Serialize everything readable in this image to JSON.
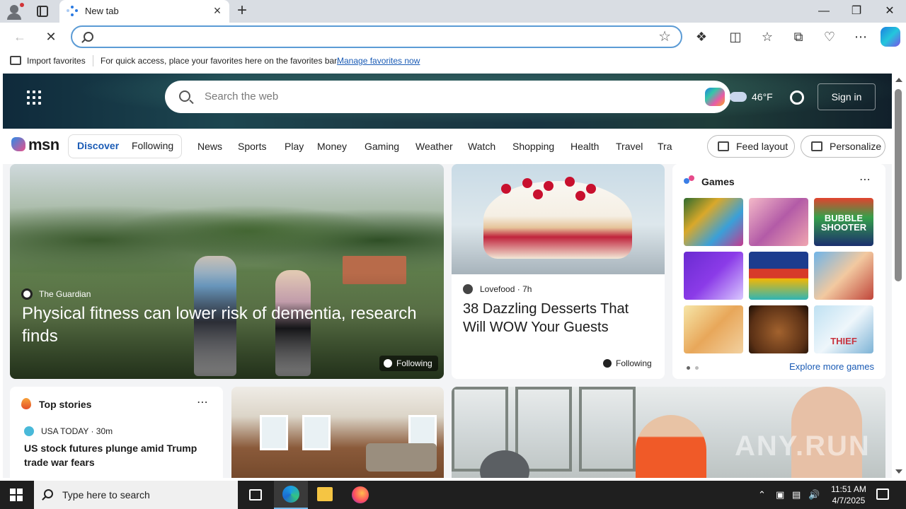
{
  "browser": {
    "tab_title": "New tab",
    "address_value": "",
    "favorites_bar": {
      "import_label": "Import favorites",
      "hint": "For quick access, place your favorites here on the favorites bar.",
      "manage_link": "Manage favorites now"
    }
  },
  "page": {
    "search_placeholder": "Search the web",
    "weather_temp": "46°F",
    "signin_label": "Sign in",
    "logo_text": "msn",
    "feed_tabs": [
      {
        "label": "Discover",
        "active": true
      },
      {
        "label": "Following",
        "active": false
      }
    ],
    "nav_links": [
      "News",
      "Sports",
      "Play",
      "Money",
      "Gaming",
      "Weather",
      "Watch",
      "Shopping",
      "Health",
      "Travel",
      "Tra"
    ],
    "feed_layout_label": "Feed layout",
    "personalize_label": "Personalize",
    "hero_card": {
      "source": "The Guardian",
      "headline": "Physical fitness can lower risk of dementia, research finds",
      "following_label": "Following"
    },
    "dessert_card": {
      "source": "Lovefood",
      "age": "7h",
      "headline": "38 Dazzling Desserts That Will WOW Your Guests",
      "following_label": "Following"
    },
    "games": {
      "title": "Games",
      "explore_label": "Explore more games",
      "tiles": [
        {
          "name": "jewel-puzzle-tile",
          "label": ""
        },
        {
          "name": "makeup-brushes-tile",
          "label": ""
        },
        {
          "name": "bubble-shooter-tile",
          "label": "BUBBLE SHOOTER"
        },
        {
          "name": "crazy-games-tile",
          "label": ""
        },
        {
          "name": "block-puzzle-tile",
          "label": ""
        },
        {
          "name": "cartoon-character-tile",
          "label": ""
        },
        {
          "name": "shiba-dog-tile",
          "label": ""
        },
        {
          "name": "deer-hunter-tile",
          "label": ""
        },
        {
          "name": "stickman-thief-tile",
          "label": "THIEF"
        }
      ]
    },
    "top_stories": {
      "title": "Top stories",
      "source": "USA TODAY · 30m",
      "headline": "US stock futures plunge amid Trump trade war fears"
    },
    "watermark": "ANY.RUN"
  },
  "taskbar": {
    "search_placeholder": "Type here to search",
    "time": "11:51 AM",
    "date": "4/7/2025"
  },
  "colors": {
    "accent": "#1a5bb5",
    "address_focus": "#5b9bd5",
    "taskbar": "#1f1f1f"
  }
}
